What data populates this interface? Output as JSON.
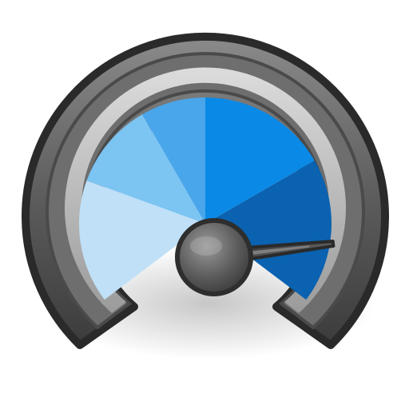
{
  "icon": {
    "name": "speedometer-gauge-icon",
    "needle_level": 0.12,
    "colors": {
      "bezel_dark": "#3a3a3a",
      "bezel_mid": "#6b6b6b",
      "bezel_light": "#9a9a9a",
      "rim_light": "#c8c8c8",
      "dial_segment_1": "#bfe0f7",
      "dial_segment_2": "#7cc4f2",
      "dial_segment_3": "#4aa6ea",
      "dial_segment_4": "#0a8ae6",
      "dial_segment_5": "#0a62b0",
      "needle": "#3c3c3c",
      "hub": "#5e5e5e",
      "shadow": "#d9d9d9"
    }
  }
}
